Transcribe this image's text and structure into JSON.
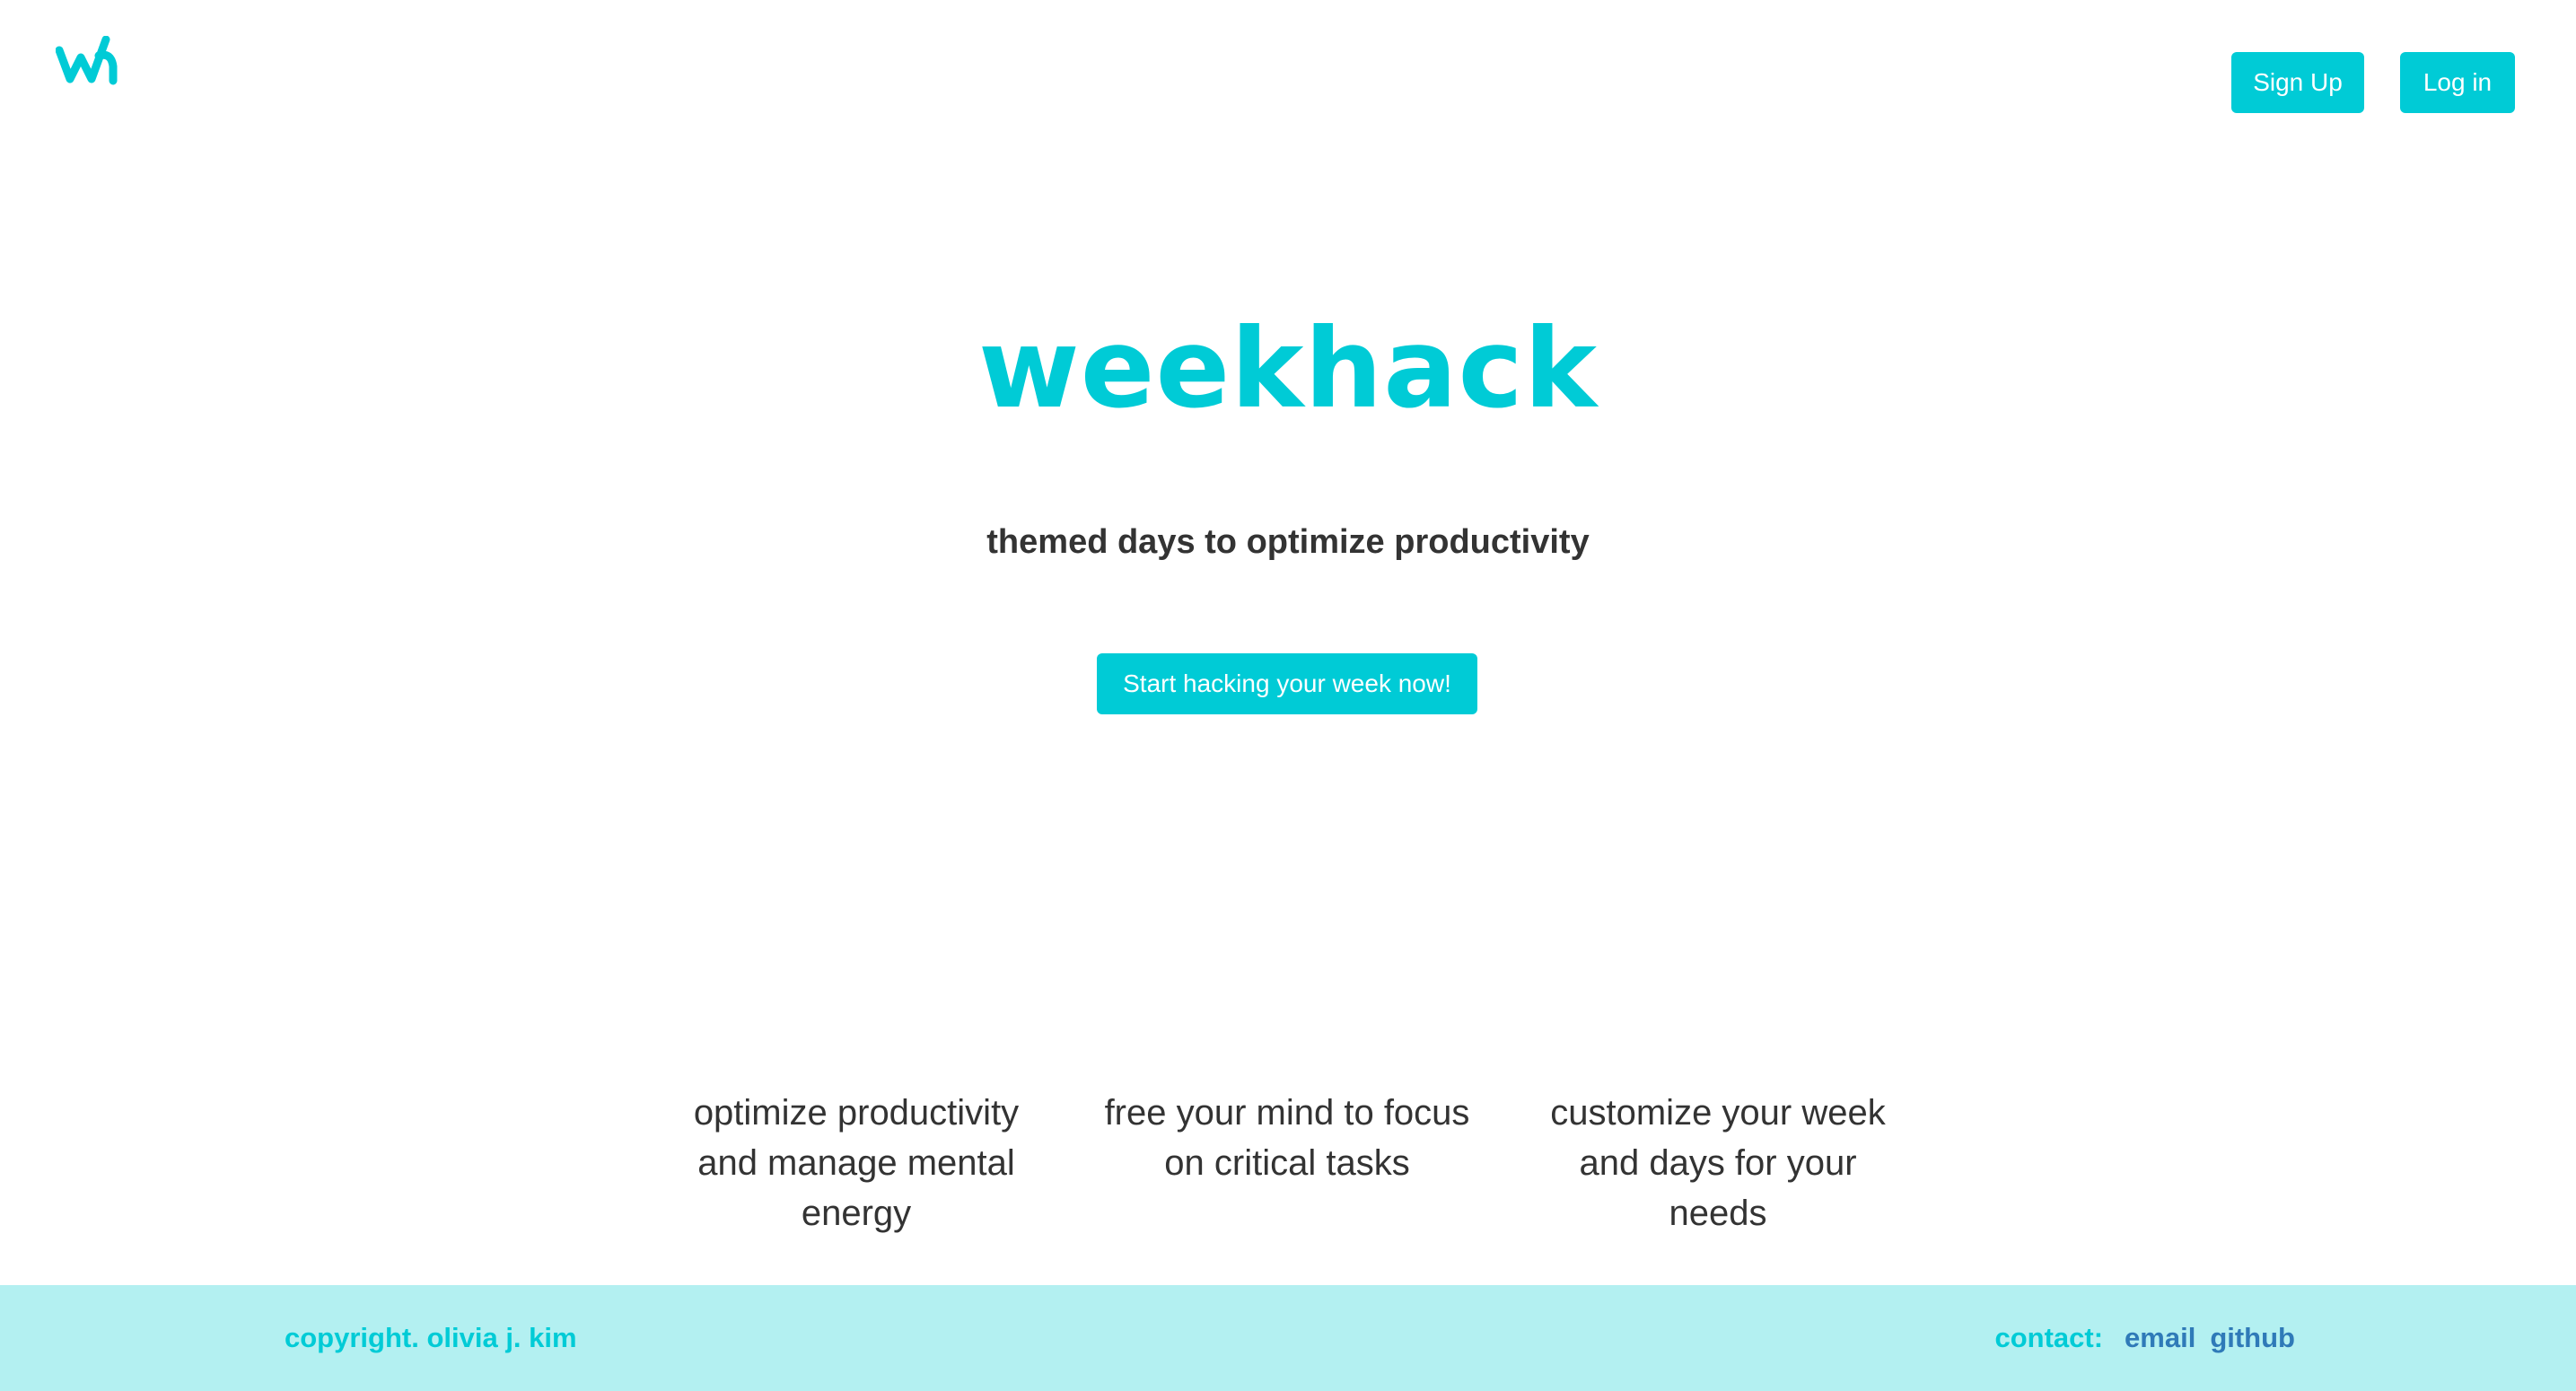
{
  "brand": {
    "logo_text": "wh",
    "logo_icon": "wh-monogram-icon",
    "accent_color": "#00cbd6",
    "footer_bg_color": "#b3f0f1",
    "link_color": "#2f7ab8"
  },
  "header": {
    "signup_label": "Sign Up",
    "login_label": "Log in"
  },
  "hero": {
    "title": "weekhack",
    "subtitle": "themed days to optimize productivity",
    "cta_label": "Start hacking your week now!"
  },
  "features": [
    {
      "text": "optimize productivity and manage mental energy"
    },
    {
      "text": "free your mind to focus on critical tasks"
    },
    {
      "text": "customize your week and days for your needs"
    }
  ],
  "footer": {
    "copyright": "copyright. olivia j. kim",
    "contact_label": "contact:",
    "links": [
      {
        "label": "email"
      },
      {
        "label": "github"
      }
    ]
  }
}
